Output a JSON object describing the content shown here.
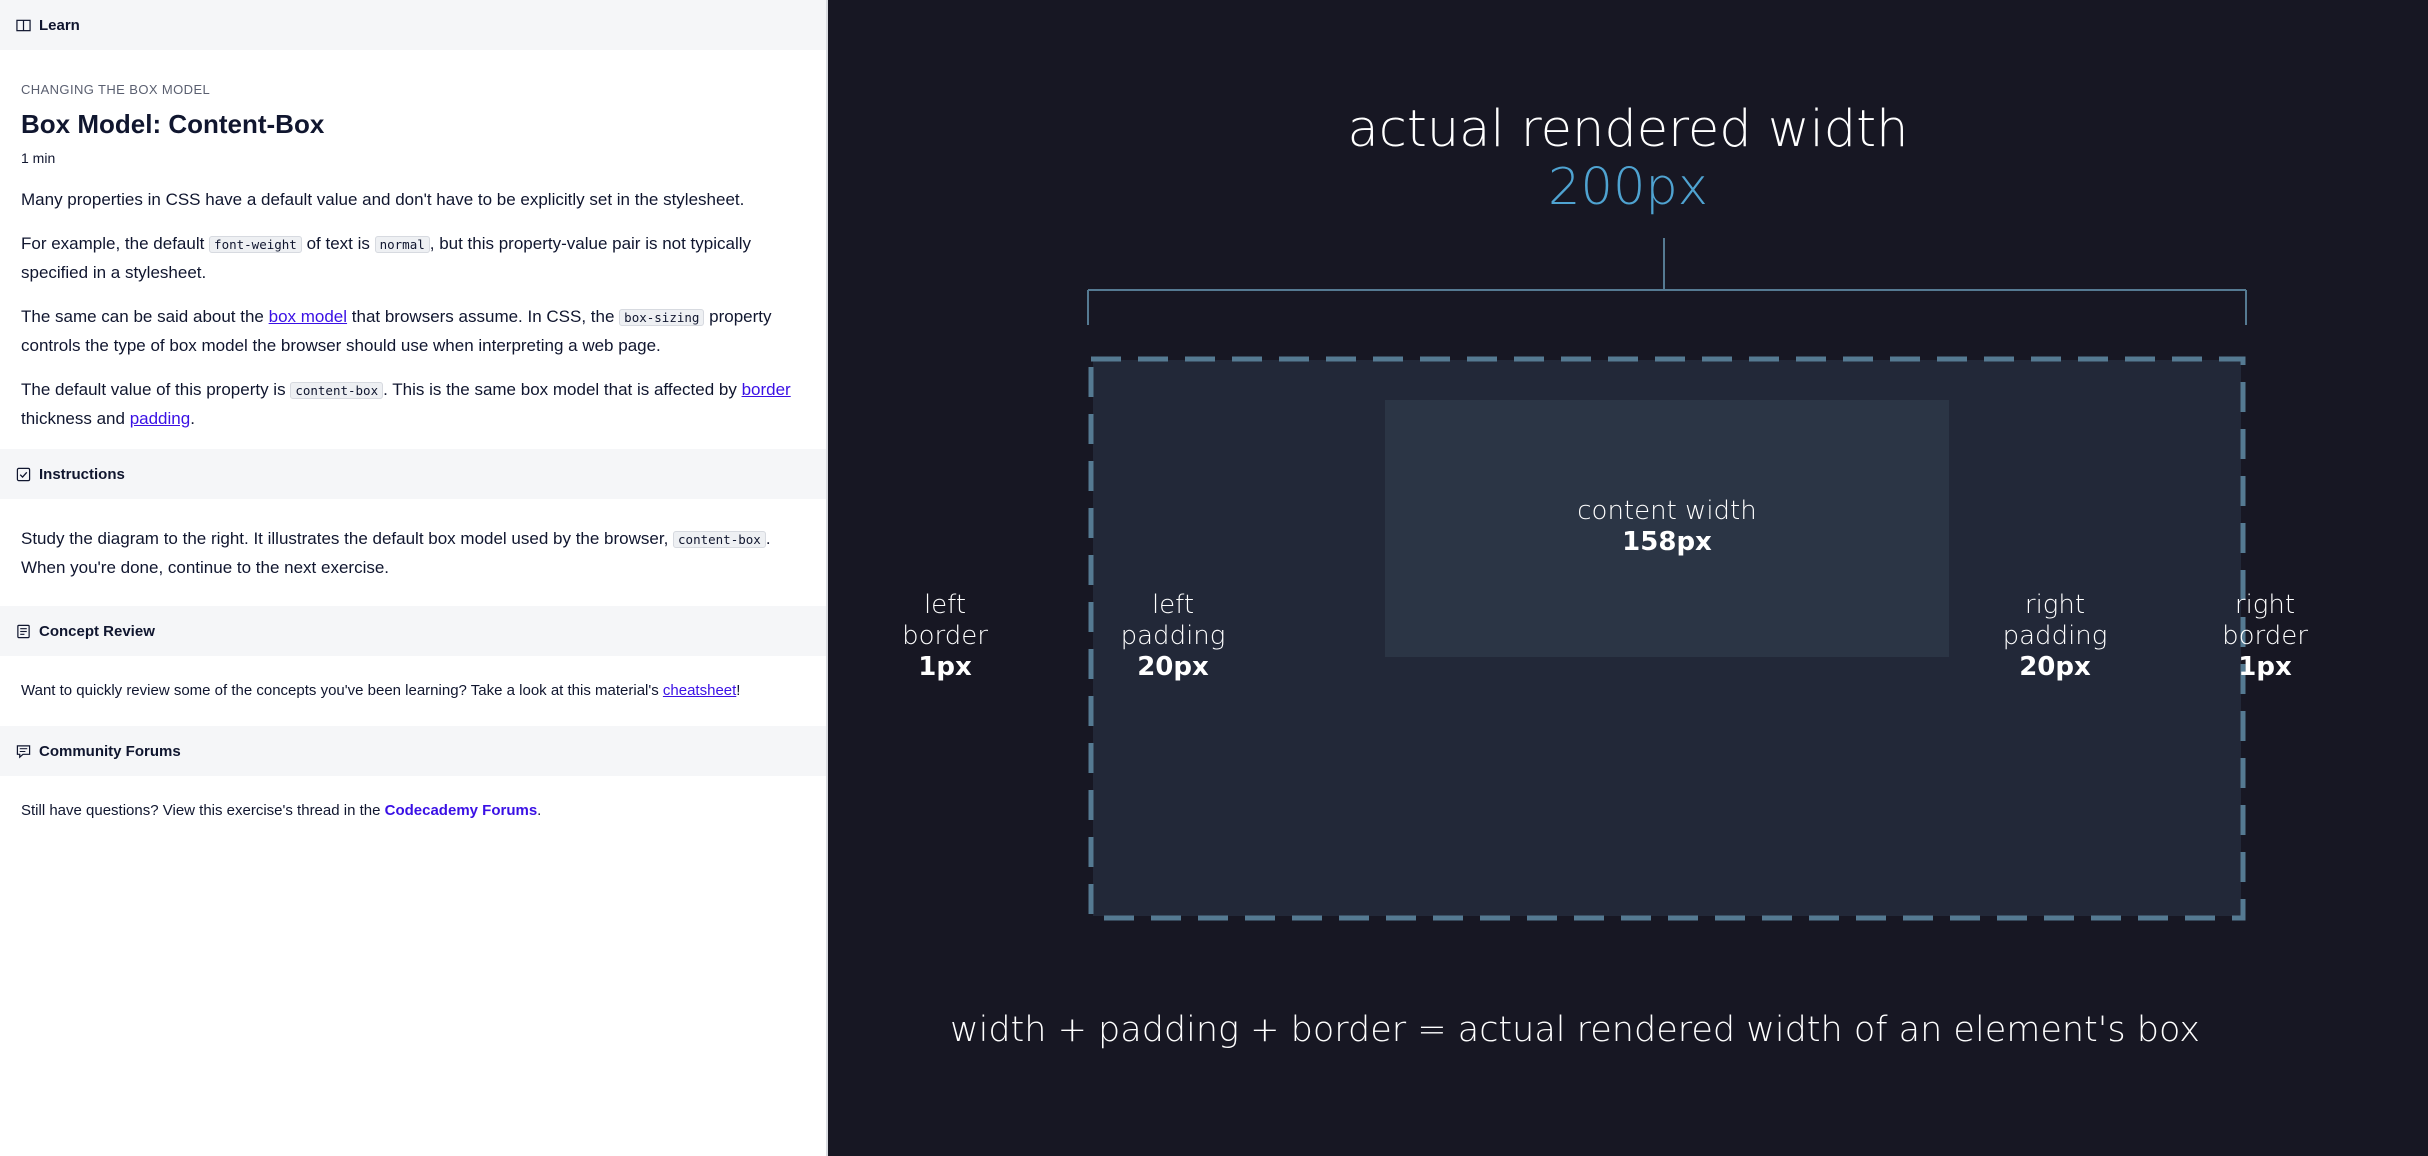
{
  "left": {
    "learn": {
      "title": "Learn",
      "icon": "book-icon"
    },
    "eyebrow": "CHANGING THE BOX MODEL",
    "title": "Box Model: Content-Box",
    "duration": "1 min",
    "p1": "Many properties in CSS have a default value and don't have to be explicitly set in the stylesheet.",
    "p2": {
      "a": "For example, the default ",
      "code1": "font-weight",
      "b": " of text is ",
      "code2": "normal",
      "c": ", but this property-value pair is not typically specified in a stylesheet."
    },
    "p3": {
      "a": "The same can be said about the ",
      "link": "box model",
      "b": " that browsers assume. In CSS, the ",
      "code": "box-sizing",
      "c": " property controls the type of box model the browser should use when interpreting a web page."
    },
    "p4": {
      "a": "The default value of this property is ",
      "code": "content-box",
      "b": ". This is the same box model that is affected by ",
      "link1": "border",
      "c": " thickness and ",
      "link2": "padding",
      "d": "."
    },
    "instructions": {
      "title": "Instructions",
      "icon": "checkbox-icon",
      "a": "Study the diagram to the right. It illustrates the default box model used by the browser, ",
      "code": "content-box",
      "b": ". When you're done, continue to the next exercise."
    },
    "concept": {
      "title": "Concept Review",
      "icon": "document-icon",
      "a": "Want to quickly review some of the concepts you've been learning? Take a look at this material's ",
      "link": "cheatsheet",
      "b": "!"
    },
    "forums": {
      "title": "Community Forums",
      "icon": "chat-icon",
      "a": "Still have questions? View this exercise's thread in the ",
      "link": "Codecademy Forums",
      "b": "."
    }
  },
  "diagram": {
    "heading": "actual rendered width",
    "total": "200px",
    "content_label": "content width",
    "content_value": "158px",
    "left_border": {
      "line1": "left",
      "line2": "border",
      "value": "1px"
    },
    "left_padding": {
      "line1": "left",
      "line2": "padding",
      "value": "20px"
    },
    "right_padding": {
      "line1": "right",
      "line2": "padding",
      "value": "20px"
    },
    "right_border": {
      "line1": "right",
      "line2": "border",
      "value": "1px"
    },
    "equation": "width + padding + border = actual rendered width of an element's box",
    "colors": {
      "background": "#171723",
      "box": "#222838",
      "content": "#2b3545",
      "border": "#557a92",
      "accent": "#4fa3d1"
    }
  }
}
